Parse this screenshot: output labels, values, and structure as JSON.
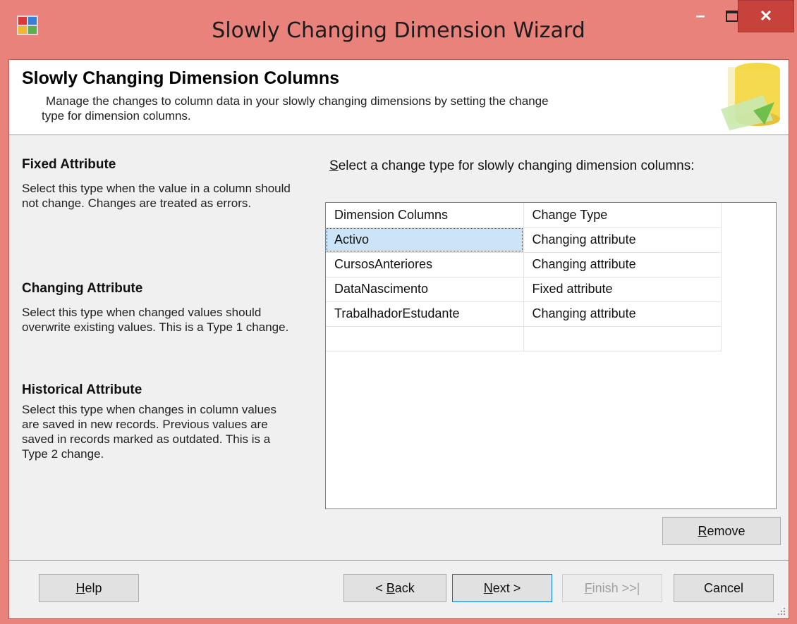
{
  "window": {
    "title": "Slowly Changing Dimension Wizard",
    "minimize_glyph": "–",
    "close_glyph": "✕"
  },
  "header": {
    "title": "Slowly Changing Dimension Columns",
    "description_line1": "Manage the changes to column data in your slowly changing dimensions by setting the change",
    "description_line2": "type for dimension columns."
  },
  "sidebar": {
    "fixed": {
      "heading": "Fixed Attribute",
      "text": "Select this type when the value in a column should not change. Changes are treated as errors."
    },
    "changing": {
      "heading": "Changing Attribute",
      "text": "Select this type when changed values should overwrite existing values. This is a Type 1 change."
    },
    "historical": {
      "heading": "Historical Attribute",
      "text": "Select this type when changes in column values are saved in new records. Previous values are saved in records marked as outdated. This is a Type 2 change."
    }
  },
  "prompt": {
    "mnemonic": "S",
    "rest": "elect a change type for slowly changing dimension columns:"
  },
  "grid": {
    "headers": [
      "Dimension Columns",
      "Change Type"
    ],
    "rows": [
      [
        "Activo",
        "Changing attribute"
      ],
      [
        "CursosAnteriores",
        "Changing attribute"
      ],
      [
        "DataNascimento",
        "Fixed attribute"
      ],
      [
        "TrabalhadorEstudante",
        "Changing attribute"
      ],
      [
        "",
        ""
      ]
    ]
  },
  "buttons": {
    "remove": {
      "mnemonic": "R",
      "rest": "emove"
    },
    "help": {
      "mnemonic": "H",
      "rest": "elp"
    },
    "back": {
      "pre": "< ",
      "mnemonic": "B",
      "rest": "ack"
    },
    "next": {
      "mnemonic": "N",
      "rest": "ext >"
    },
    "finish": {
      "mnemonic": "F",
      "rest": "inish >>|"
    },
    "cancel": "Cancel"
  },
  "colors": {
    "frame": "#e9827a",
    "close_button": "#c7423a",
    "selection": "#cce4f7"
  }
}
